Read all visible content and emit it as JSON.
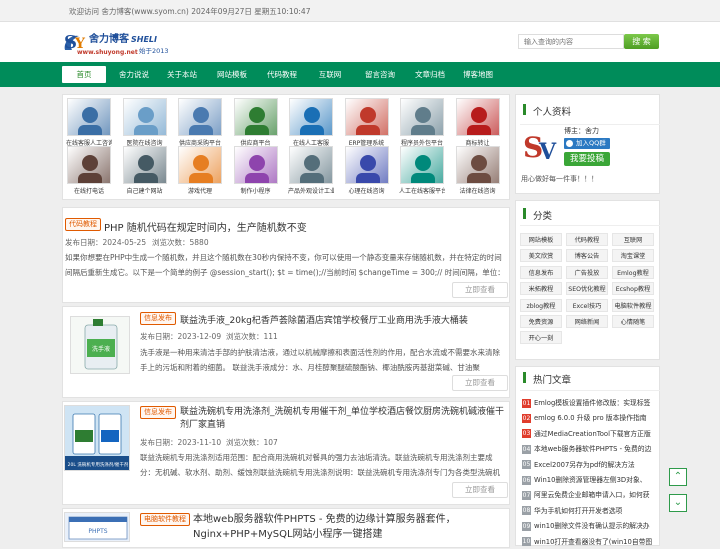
{
  "topbar": {
    "welcome": "欢迎访问 舍力博客(www.syom.cn)  2024年09月27日 星期五10:10:47"
  },
  "logo": {
    "title": "舍力博客",
    "subtitle": "SHELI",
    "url": "www.shuyong.net",
    "slogan": "始于2013"
  },
  "search": {
    "placeholder": "输入查询的内容",
    "button": "搜 索"
  },
  "nav": [
    "首页",
    "舍力说说",
    "关于本站",
    "网站模板",
    "代码教程",
    "互联网",
    "留言咨询",
    "文章归档",
    "博客地图"
  ],
  "grid": [
    {
      "label": "在线客服人工咨询",
      "color": "#3a6ea5"
    },
    {
      "label": "医院在线咨询",
      "color": "#6a9ec8"
    },
    {
      "label": "供应商采购平台",
      "color": "#4a7ab0"
    },
    {
      "label": "供应商平台",
      "color": "#2e7d32"
    },
    {
      "label": "在线人工客服",
      "color": "#1a6fb5"
    },
    {
      "label": "ERP管理系统",
      "color": "#c0392b"
    },
    {
      "label": "程序员外包平台",
      "color": "#607d8b"
    },
    {
      "label": "商标转让",
      "color": "#b71c1c"
    },
    {
      "label": "在线打电话",
      "color": "#5d4037"
    },
    {
      "label": "自己建个网站",
      "color": "#455a64"
    },
    {
      "label": "游戏代理",
      "color": "#e67e22"
    },
    {
      "label": "制作小程序",
      "color": "#8e44ad"
    },
    {
      "label": "产品外观设计工业",
      "color": "#546e7a"
    },
    {
      "label": "心理在线咨询",
      "color": "#3949ab"
    },
    {
      "label": "人工在线客服平台",
      "color": "#00897b"
    },
    {
      "label": "法律在线咨询",
      "color": "#6d4c41"
    }
  ],
  "articles": [
    {
      "tag": "代码教程",
      "title": "PHP 随机代码在规定时间内，生产随机数不变",
      "date": "发布日期：2024-05-25",
      "views": "浏览次数：5880",
      "excerpt": "如果你想要在PHP中生成一个随机数，并且这个随机数在30秒内保持不变，你可以使用一个静态变量来存储随机数，并在特定的时间间隔后重新生成它。以下是一个简单的例子 @session_start(); $t = time();//当前时间 $changeTime = 300;// 时间间隔，单位：秒",
      "more": "立即查看"
    },
    {
      "tag": "信息发布",
      "title": "联益洗手液_20kg杞香芦荟除菌酒店宾馆学校餐厅工业商用洗手液大桶装",
      "date": "发布日期：2023-12-09",
      "views": "浏览次数：111",
      "excerpt": "洗手液是一种用来清洁手部的护肤清洁液，通过以机械摩擦和表面活性剂的作用，配合水流或不需要水来清除手上的污垢和附着的细菌。 联益洗手液成分：水、月桂醇聚醚硫酸酯钠、椰油酰胺丙基甜菜碱、甘油聚",
      "more": "立即查看"
    },
    {
      "tag": "信息发布",
      "title": "联益洗碗机专用洗涤剂_洗碗机专用催干剂_单位学校酒店餐饮厨房洗碗机碱液催干剂厂家直销",
      "date": "发布日期：2023-11-10",
      "views": "浏览次数：107",
      "excerpt": "联益洗碗机专用洗涤剂适用范围：配合商用洗碗机对餐具的强力去油垢清洗。联益洗碗机专用洗涤剂主要成分：无机碱、软水剂、助剂、缓蚀剂联益洗碗机专用洗涤剂说明：联益洗碗机专用洗涤剂专门为各类型洗碗机",
      "more": "立即查看"
    },
    {
      "tag": "电脑软件教程",
      "title": "本地web服务器软件PHPTS - 免费的边缘计算服务器套件，Nginx+PHP+MySQL网站小程序一键搭建"
    }
  ],
  "thumbs": {
    "img2_text": "洗手液",
    "img3_text": "20L 洗碗机专用洗涤剂/催干剂",
    "img4_text": "PHPTS"
  },
  "profile": {
    "heading": "个人资料",
    "blogger": "博主：舍力",
    "qq": "加入QQ群",
    "contact": "我要投稿",
    "motto": "用心做好每一件事！！！"
  },
  "categories": {
    "heading": "分类",
    "items": [
      "网站模板",
      "代码教程",
      "互联网",
      "美文欣赏",
      "博客公告",
      "淘宝课堂",
      "信息发布",
      "广告投放",
      "Emlog教程",
      "米拓教程",
      "SEO优化教程",
      "Ecshop教程",
      "zblog教程",
      "Excel技巧",
      "电脑软件教程",
      "免费资源",
      "网络新闻",
      "心情随笔",
      "开心一刻"
    ]
  },
  "hot": {
    "heading": "热门文章",
    "items": [
      {
        "num": "01",
        "title": "Emlog模板设置插件修改版：实现标签"
      },
      {
        "num": "02",
        "title": "emlog 6.0.0 升级 pro 版本操作指南"
      },
      {
        "num": "03",
        "title": "通过MediaCreationTool下载官方正版"
      },
      {
        "num": "04",
        "title": "本地web服务器软件PHPTS - 免费的边"
      },
      {
        "num": "05",
        "title": "Excel2007另存为pdf的解决方法"
      },
      {
        "num": "06",
        "title": "Win10删除资源管理器左侧3D对象、"
      },
      {
        "num": "07",
        "title": "阿里云免费企业邮箱申请入口，如何获"
      },
      {
        "num": "08",
        "title": "华为手机如何打开开发者选项"
      },
      {
        "num": "09",
        "title": "win10删除文件没有确认提示的解决办"
      },
      {
        "num": "10",
        "title": "win10打开查看器没有了(win10自带图"
      }
    ]
  },
  "colors": {
    "nav": "#008c5a",
    "accent": "#2a8a2a",
    "tag": "#e05a00",
    "hot_top": "#e03c2c",
    "hot_rest": "#9aa0a6"
  }
}
